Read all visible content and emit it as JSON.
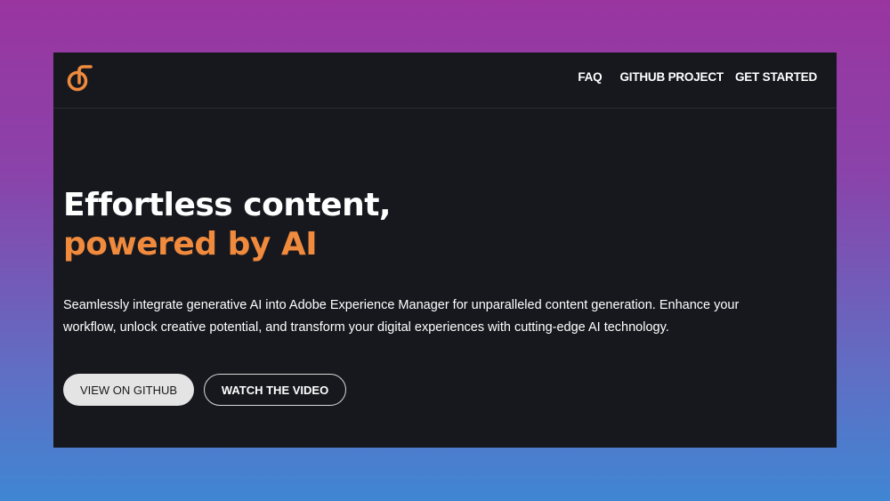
{
  "nav": {
    "logo_icon": "dot-hook-logo-icon",
    "links": [
      {
        "label": "FAQ"
      },
      {
        "label": "GITHUB PROJECT"
      },
      {
        "label": "GET STARTED"
      }
    ]
  },
  "hero": {
    "title_line1": "Effortless content,",
    "title_line2": "powered by AI",
    "description": "Seamlessly integrate generative AI into Adobe Experience Manager for unparalleled content generation. Enhance your workflow, unlock creative potential, and transform your digital experiences with cutting-edge AI technology."
  },
  "buttons": {
    "primary_label": "VIEW ON GITHUB",
    "secondary_label": "WATCH THE VIDEO"
  },
  "colors": {
    "accent": "#f08a3d",
    "frame_bg": "#17181e",
    "bg_gradient_top": "#9a35a0",
    "bg_gradient_bottom": "#3f86d3"
  }
}
